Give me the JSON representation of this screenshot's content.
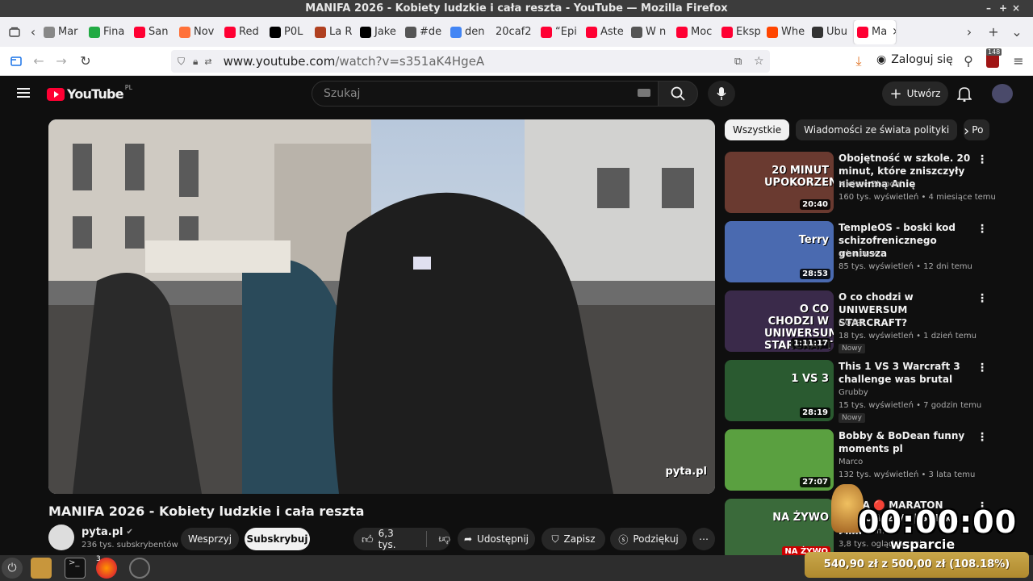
{
  "window": {
    "title": "MANIFA 2026 - Kobiety ludzkie i cała reszta - YouTube — Mozilla Firefox"
  },
  "tabs": [
    {
      "label": "Mar",
      "icon": "page-icon",
      "color": "#888888"
    },
    {
      "label": "Fina",
      "icon": "k-icon",
      "color": "#22aa44"
    },
    {
      "label": "San",
      "icon": "youtube-icon",
      "color": "#ff0033"
    },
    {
      "label": "Nov",
      "icon": "firefox-icon",
      "color": "#ff7139"
    },
    {
      "label": "Red",
      "icon": "youtube-icon",
      "color": "#ff0033"
    },
    {
      "label": "P0L",
      "icon": "x-icon",
      "color": "#000000"
    },
    {
      "label": "La R",
      "icon": "shield-icon",
      "color": "#b04020"
    },
    {
      "label": "Jake",
      "icon": "x-icon",
      "color": "#000000"
    },
    {
      "label": "#de",
      "icon": "hash-icon",
      "color": "#555555"
    },
    {
      "label": "den",
      "icon": "google-icon",
      "color": "#4285f4"
    },
    {
      "label": "20caf2",
      "icon": "none",
      "color": "#ffffff"
    },
    {
      "label": "“Epi",
      "icon": "youtube-icon",
      "color": "#ff0033"
    },
    {
      "label": "Aste",
      "icon": "youtube-icon",
      "color": "#ff0033"
    },
    {
      "label": "W n",
      "icon": "hash-icon",
      "color": "#555555"
    },
    {
      "label": "Moc",
      "icon": "youtube-icon",
      "color": "#ff0033"
    },
    {
      "label": "Eksp",
      "icon": "youtube-icon",
      "color": "#ff0033"
    },
    {
      "label": "Whe",
      "icon": "reddit-icon",
      "color": "#ff4500"
    },
    {
      "label": "Ubu",
      "icon": "wikipedia-icon",
      "color": "#333333"
    },
    {
      "label": "Ma",
      "icon": "youtube-icon",
      "color": "#ff0033",
      "active": true
    }
  ],
  "nav": {
    "url_host": "www.youtube.com",
    "url_path": "/watch?v=s351aK4HgeA",
    "login_label": "Zaloguj się",
    "ext_badge": "148"
  },
  "yt": {
    "logo_text": "YouTube",
    "logo_region": "PL",
    "search_placeholder": "Szukaj",
    "create_label": "Utwórz",
    "video_title": "MANIFA 2026 - Kobiety ludzkie i cała reszta",
    "watermark": "pyta.pl",
    "channel": {
      "name": "pyta.pl",
      "subs": "236 tys. subskrybentów"
    },
    "support_label": "Wesprzyj",
    "subscribe_label": "Subskrybuj",
    "likes": "6,3 tys.",
    "share_label": "Udostępnij",
    "save_label": "Zapisz",
    "thanks_label": "Podziękuj",
    "chips": [
      "Wszystkie",
      "Wiadomości ze świata polityki",
      "Po"
    ],
    "recommendations": [
      {
        "title": "Obojętność w szkole. 20 minut, które zniszczyły niewinną Anię",
        "channel": "Miejsce Zbrodni",
        "meta": "160 tys. wyświetleń • 4 miesiące temu",
        "duration": "20:40",
        "thumb_text": "20 MINUT UPOKORZENIA",
        "badge": "",
        "verified": false,
        "thumb_color": "#6a3a30"
      },
      {
        "title": "TempleOS - boski kod schizofrenicznego geniusza",
        "channel": "arhn.eu",
        "meta": "85 tys. wyświetleń • 12 dni temu",
        "duration": "28:53",
        "thumb_text": "Terry",
        "badge": "",
        "verified": true,
        "thumb_color": "#4a6ab0"
      },
      {
        "title": "O co chodzi w UNIWERSUM STARCRAFT?",
        "channel": "GOTRI",
        "meta": "18 tys. wyświetleń • 1 dzień temu",
        "duration": "1:11:17",
        "thumb_text": "O CO CHODZI W UNIWERSUM STARCRAFT",
        "badge": "Nowy",
        "verified": false,
        "thumb_color": "#3a2a4a"
      },
      {
        "title": "This 1 VS 3 Warcraft 3 challenge was brutal",
        "channel": "Grubby",
        "meta": "15 tys. wyświetleń • 7 godzin temu",
        "duration": "28:19",
        "thumb_text": "1 VS 3",
        "badge": "Nowy",
        "verified": false,
        "thumb_color": "#2a5a30"
      },
      {
        "title": "Bobby & BoDean funny moments pl",
        "channel": "Marco",
        "meta": "132 tys. wyświetleń • 3 lata temu",
        "duration": "27:07",
        "thumb_text": "",
        "badge": "",
        "verified": false,
        "thumb_color": "#5aa040"
      },
      {
        "title": "EKIPA 🔴 MARATON CINKÓW 24/7 | SPIaka Film",
        "channel": "SPIaka Film",
        "meta": "3,8 tys. oglądających",
        "duration": "",
        "thumb_text": "NA ŻYWO",
        "badge": "",
        "verified": false,
        "thumb_color": "#3a6a3a",
        "live_label": "NA ŻYWO"
      }
    ]
  },
  "overlay": {
    "timer": "00:00:00",
    "sub": "wsparcie",
    "goal": "540,90 zł z 500,00 zł (108.18%)"
  },
  "taskbar": {
    "ff_badge": "3"
  }
}
